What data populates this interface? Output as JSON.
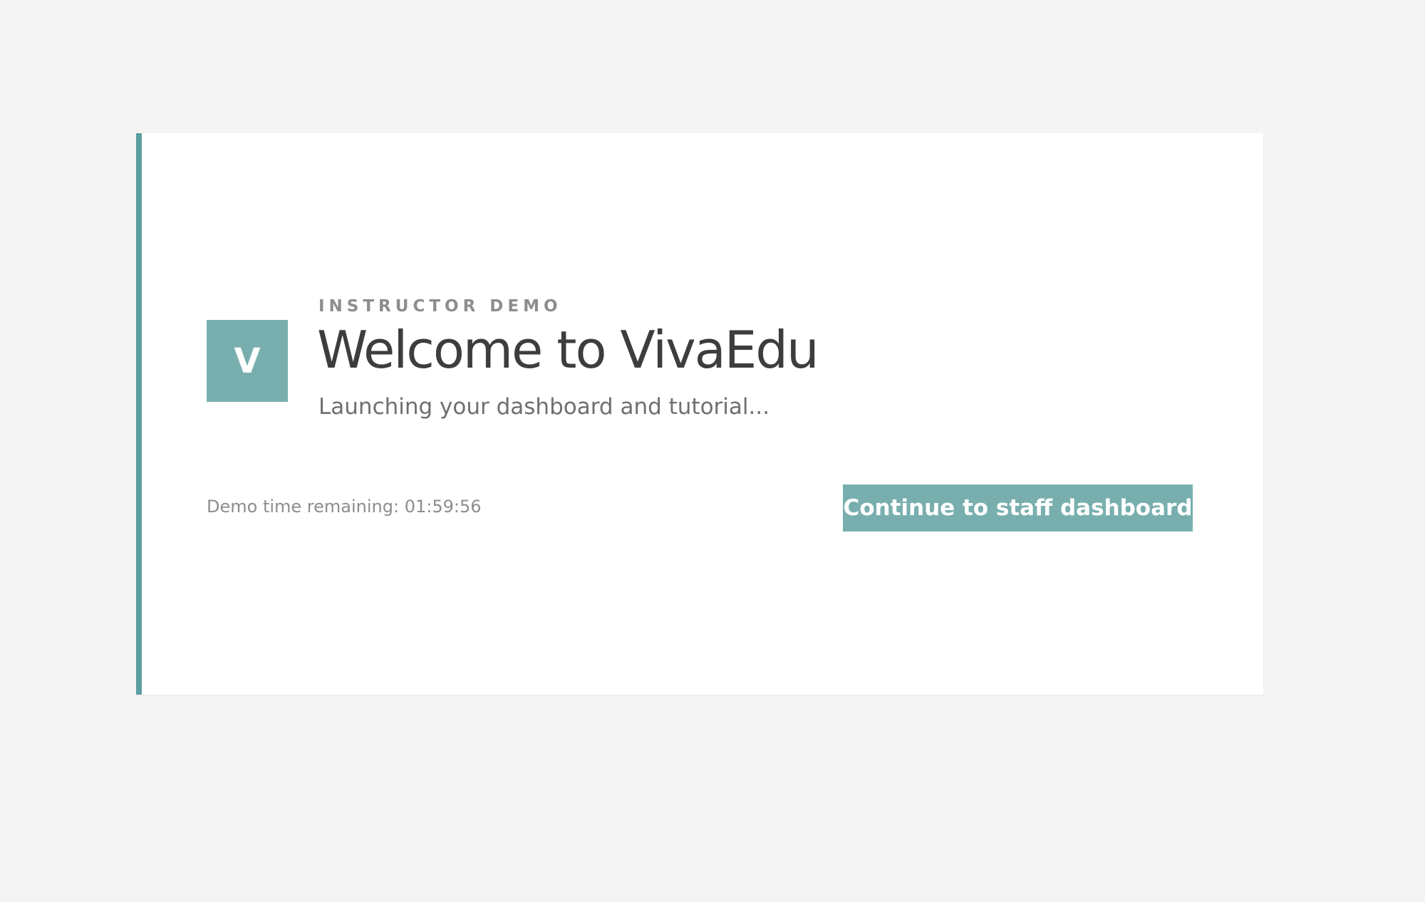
{
  "card": {
    "logo_letter": "V",
    "eyebrow": "INSTRUCTOR DEMO",
    "title": "Welcome to VivaEdu",
    "subtitle": "Launching your dashboard and tutorial...",
    "timer_text": "Demo time remaining: 01:59:56",
    "cta_label": "Continue to staff dashboard"
  },
  "colors": {
    "background": "#f4f4f4",
    "card": "#ffffff",
    "accent": "#5b9ea0",
    "button": "#78afae",
    "logo": "#78afae"
  }
}
